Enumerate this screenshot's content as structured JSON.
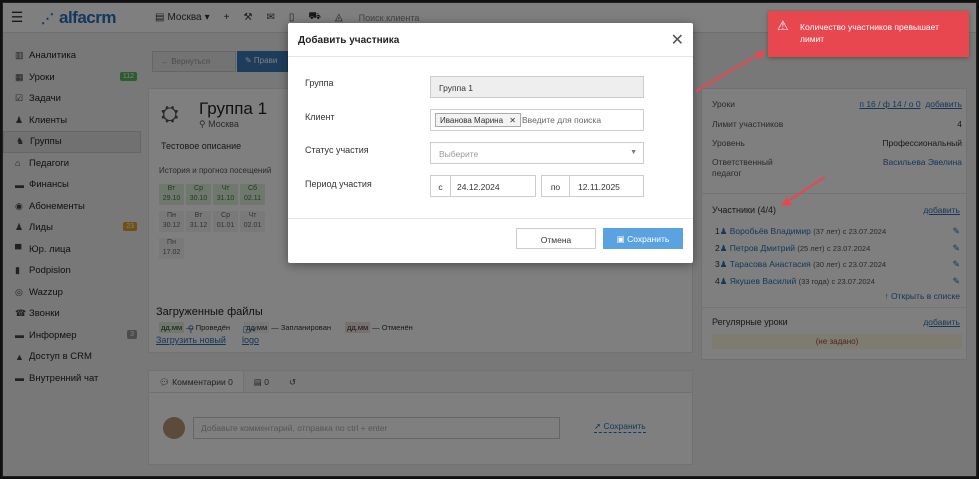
{
  "topbar": {
    "brand": "alfacrm",
    "city": "Москва",
    "search_placeholder": "Поиск клиента"
  },
  "sidebar": {
    "items": [
      {
        "label": "Аналитика",
        "icon": "chart-icon"
      },
      {
        "label": "Уроки",
        "icon": "calendar-icon",
        "badge": "112",
        "badge_color": "#5cb85c"
      },
      {
        "label": "Задачи",
        "icon": "tasks-icon"
      },
      {
        "label": "Клиенты",
        "icon": "user-icon"
      },
      {
        "label": "Группы",
        "icon": "users-icon"
      },
      {
        "label": "Педагоги",
        "icon": "graduation-cap-icon"
      },
      {
        "label": "Финансы",
        "icon": "money-icon"
      },
      {
        "label": "Абонементы",
        "icon": "ticket-icon"
      },
      {
        "label": "Лиды",
        "icon": "lead-icon",
        "badge": "23",
        "badge_color": "#e3a02c"
      },
      {
        "label": "Юр. лица",
        "icon": "briefcase-icon"
      },
      {
        "label": "Podpislon",
        "icon": "document-icon"
      },
      {
        "label": "Wazzup",
        "icon": "whatsapp-icon"
      },
      {
        "label": "Звонки",
        "icon": "phone-icon"
      },
      {
        "label": "Информер",
        "icon": "informer-icon",
        "badge": "3",
        "badge_color": "#999999"
      },
      {
        "label": "Доступ в CRM",
        "icon": "lock-icon"
      },
      {
        "label": "Внутренний чат",
        "icon": "chat-icon"
      }
    ]
  },
  "group": {
    "title": "Группа 1",
    "city": "Москва",
    "description": "Тестовое описание",
    "history_label": "История и прогноз посещений",
    "days": [
      {
        "wd": "Вт",
        "date": "29.10",
        "state": "past"
      },
      {
        "wd": "Ср",
        "date": "30.10",
        "state": "past"
      },
      {
        "wd": "Чт",
        "date": "31.10",
        "state": "past"
      },
      {
        "wd": "Сб",
        "date": "02.11",
        "state": "past"
      },
      {
        "wd": "Пн",
        "date": "30.12",
        "state": "plan"
      },
      {
        "wd": "Вт",
        "date": "31.12",
        "state": "plan"
      },
      {
        "wd": "Ср",
        "date": "01.01",
        "state": "plan"
      },
      {
        "wd": "Чт",
        "date": "02.01",
        "state": "plan"
      },
      {
        "wd": "Пн",
        "date": "17.02",
        "state": "plan"
      }
    ],
    "legend": [
      {
        "swatch": "дд.мм",
        "text": "— Проведён",
        "color": "#dff0d8"
      },
      {
        "swatch": "дд.мм",
        "text": "— Запланирован",
        "color": "#f3f3f3"
      },
      {
        "swatch": "дд.мм",
        "text": "— Отменён",
        "color": "#f2dede"
      }
    ],
    "back_label": "← Вернуться",
    "edit_label": "✎ Прави"
  },
  "files": {
    "title": "Загруженные файлы",
    "upload_label": "Загрузить новый",
    "file_name": "logo"
  },
  "comments": {
    "tab_comments": "Комментарии 0",
    "tab_docs": "0",
    "placeholder": "Добавьте комментарий, отправка по ctrl + enter",
    "save_label": "Сохранить"
  },
  "right": {
    "lessons_label": "Уроки",
    "lessons_value": "п 16 / ф 14 / о 0",
    "add_label": "добавить",
    "limit_label": "Лимит участников",
    "limit_value": "4",
    "level_label": "Уровень",
    "level_value": "Профессиональный",
    "teacher_label": "Ответственный педагог",
    "teacher_value": "Васильева Эвелина",
    "participants_title": "Участники (4/4)",
    "participants": [
      {
        "num": "1",
        "name": "Воробьёв Владимир",
        "age": "(37 лет)",
        "since": "с 23.07.2024"
      },
      {
        "num": "2",
        "name": "Петров Дмитрий",
        "age": "(25 лет)",
        "since": "с 23.07.2024"
      },
      {
        "num": "3",
        "name": "Тарасова Анастасия",
        "age": "(30 лет)",
        "since": "с 23.07.2024"
      },
      {
        "num": "4",
        "name": "Якушев Василий",
        "age": "(33 года)",
        "since": "с 23.07.2024"
      }
    ],
    "open_list_label": "Открыть в списке",
    "regular_title": "Регулярные уроки",
    "regular_empty": "(не задано)"
  },
  "modal": {
    "title": "Добавить участника",
    "group_label": "Группа",
    "group_value": "Группа 1",
    "client_label": "Клиент",
    "client_tag": "Иванова Марина",
    "client_placeholder": "Введите для поиска",
    "status_label": "Статус участия",
    "status_placeholder": "Выберите",
    "period_label": "Период участия",
    "from_prefix": "с",
    "from_value": "24.12.2024",
    "to_prefix": "по",
    "to_value": "12.11.2025",
    "cancel_label": "Отмена",
    "save_label": "Сохранить"
  },
  "alert": {
    "text": "Количество участников превышает лимит"
  },
  "colors": {
    "accent": "#2a6fb8",
    "alert": "#e8474f",
    "save": "#5aa3e0"
  }
}
